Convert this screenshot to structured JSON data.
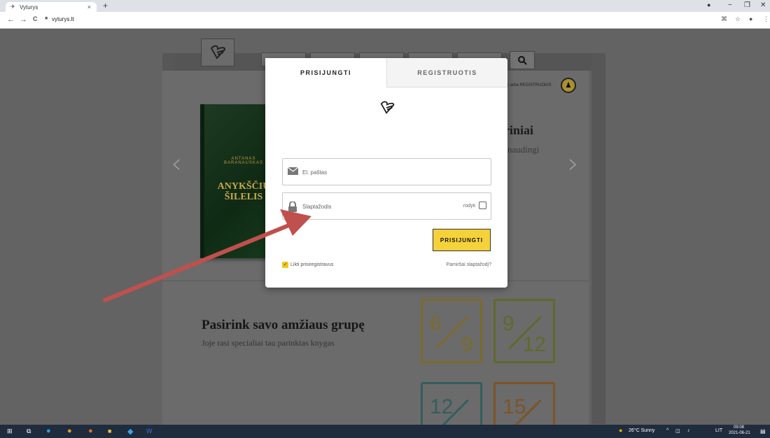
{
  "browser": {
    "tab_title": "Vyturys",
    "tab_favicon": "✈",
    "tab_close": "×",
    "new_tab": "+",
    "url": "vyturys.lt",
    "back": "←",
    "forward": "→",
    "reload": "C",
    "minimize": "−",
    "restore": "❐",
    "close": "✕"
  },
  "background": {
    "heading": "riniai",
    "subtext": "naudingi",
    "register_link": "K arba REGISTRUOKIS",
    "book_author": "ANTANAS BARANAUSKAS",
    "book_title_1": "ANYKŠČIŲ",
    "book_title_2": "ŠILELIS",
    "age_title": "Pasirink savo amžiaus grupę",
    "age_sub": "Joje rasi specialiai tau parinktas knygas",
    "age_groups": [
      {
        "a": "6",
        "b": "9",
        "color": "#c7a13a"
      },
      {
        "a": "9",
        "b": "12",
        "color": "#8fa33a"
      },
      {
        "a": "12",
        "b": "",
        "color": "#4a8c8a"
      },
      {
        "a": "15",
        "b": "",
        "color": "#c27a2a"
      }
    ]
  },
  "modal": {
    "tab_login": "PRISIJUNGTI",
    "tab_register": "REGISTRUOTIS",
    "email_placeholder": "El. paštas",
    "password_placeholder": "Slaptažodis",
    "show_password": "rodyti",
    "submit_label": "PRISIJUNGTI",
    "remember_label": "Likti prisiregistravus",
    "forgot_label": "Pamiršai slaptažodį?"
  },
  "taskbar": {
    "weather": "26°C  Sunny",
    "lang": "LIT",
    "time": "09:08",
    "date": "2021-06-21"
  },
  "colors": {
    "accent": "#f5d23a",
    "annotation_arrow": "#c0504d"
  }
}
